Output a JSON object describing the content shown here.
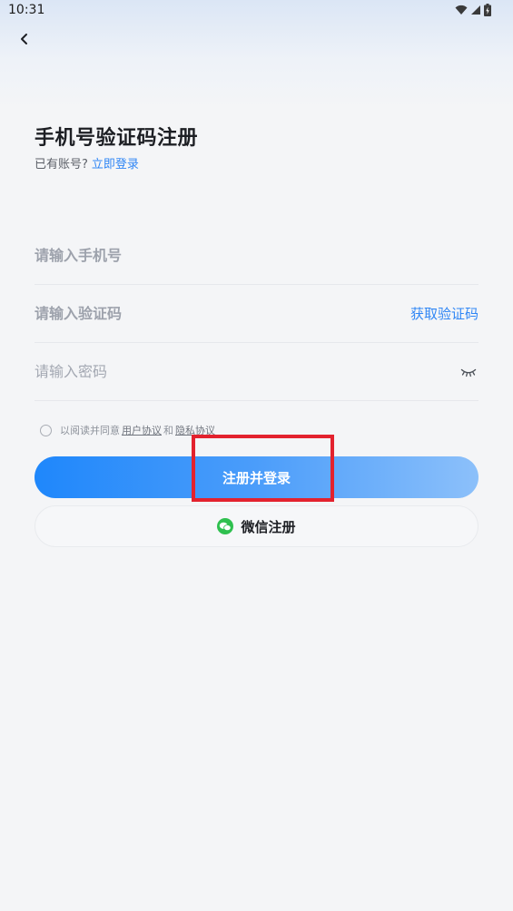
{
  "status_bar": {
    "time": "10:31"
  },
  "page": {
    "title": "手机号验证码注册",
    "subtitle_text": "已有账号?",
    "login_link": "立即登录"
  },
  "form": {
    "phone_placeholder": "请输入手机号",
    "code_placeholder": "请输入验证码",
    "get_code_label": "获取验证码",
    "password_placeholder": "请输入密码"
  },
  "agreement": {
    "prefix": "以阅读并同意",
    "user_agreement": "用户协议",
    "and": "和",
    "privacy_agreement": "隐私协议"
  },
  "buttons": {
    "register_label": "注册并登录",
    "wechat_label": "微信注册"
  },
  "colors": {
    "accent": "#2f86f5",
    "highlight": "#e3222e",
    "wechat": "#2fc04f"
  }
}
